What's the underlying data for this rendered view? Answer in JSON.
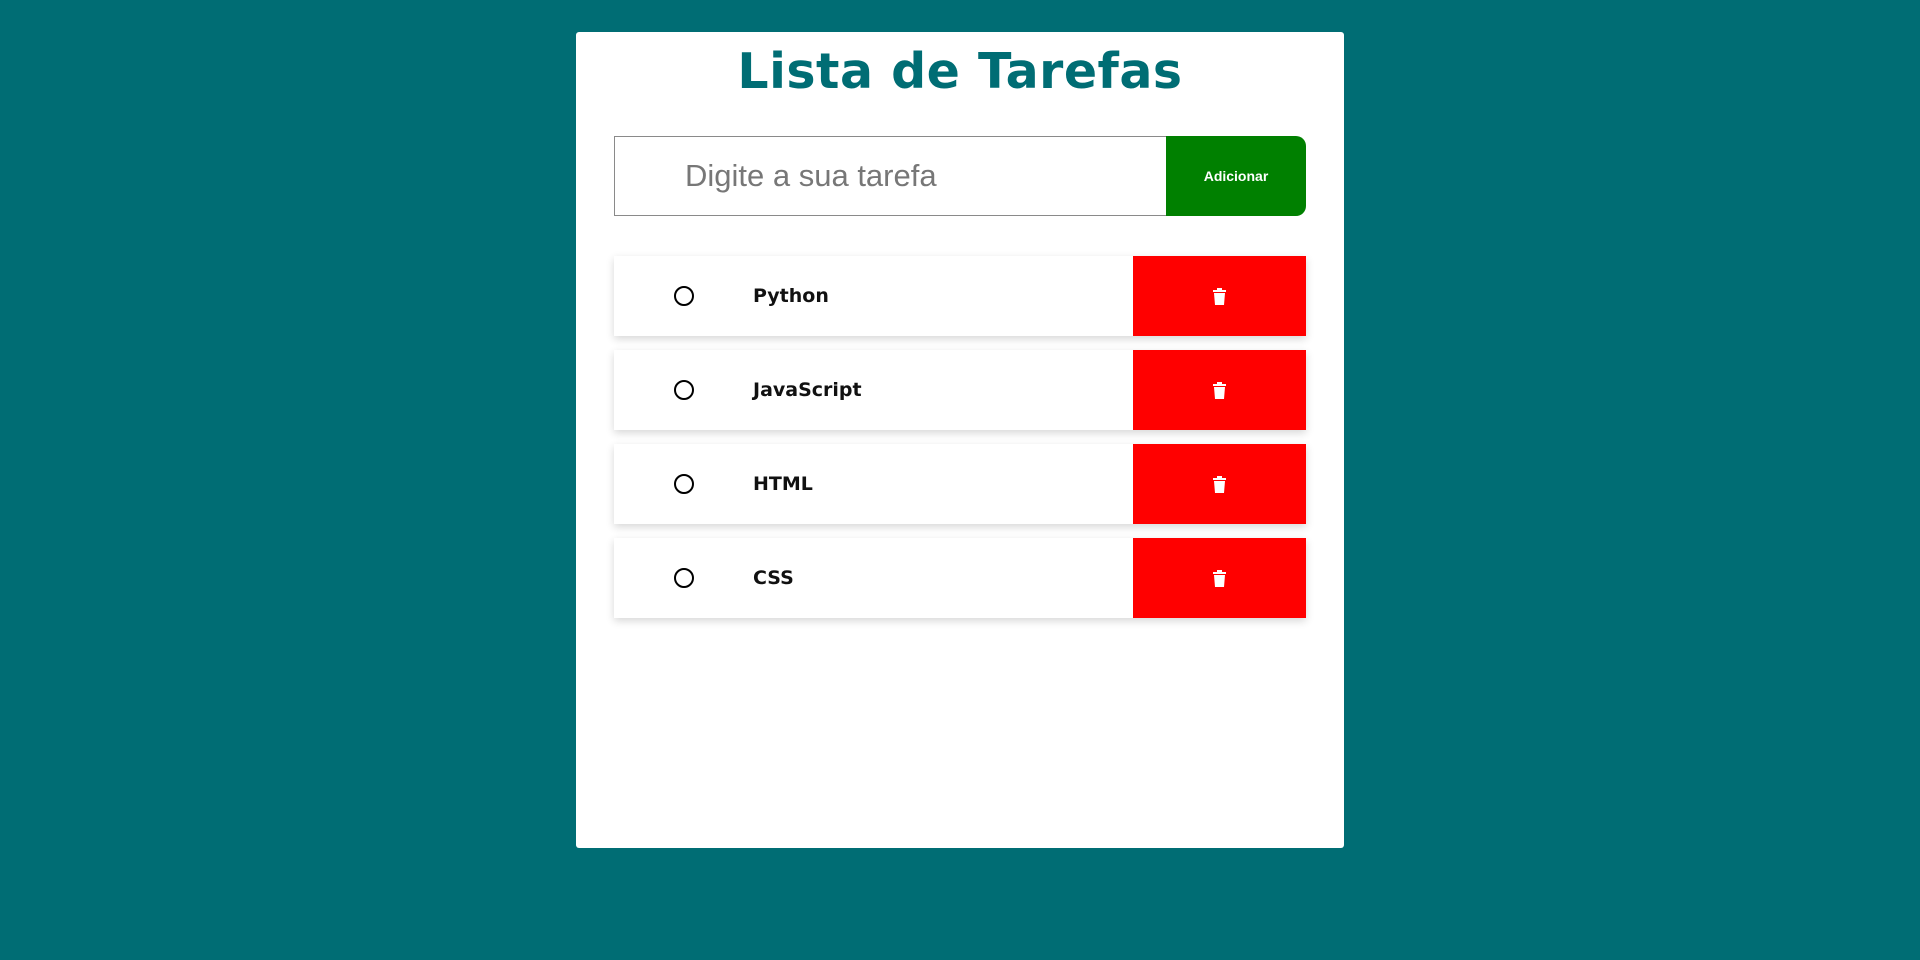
{
  "app": {
    "title": "Lista de Tarefas"
  },
  "colors": {
    "background": "#006d74",
    "card": "#ffffff",
    "title": "#006d74",
    "add_button": "#008000",
    "delete_button": "#ff0000"
  },
  "add_form": {
    "placeholder": "Digite a sua tarefa",
    "value": "",
    "button_label": "Adicionar"
  },
  "tasks": [
    {
      "label": "Python",
      "done": false,
      "check_icon": "circle-outline-icon",
      "delete_icon": "trash-icon"
    },
    {
      "label": "JavaScript",
      "done": false,
      "check_icon": "circle-outline-icon",
      "delete_icon": "trash-icon"
    },
    {
      "label": "HTML",
      "done": false,
      "check_icon": "circle-outline-icon",
      "delete_icon": "trash-icon"
    },
    {
      "label": "CSS",
      "done": false,
      "check_icon": "circle-outline-icon",
      "delete_icon": "trash-icon"
    }
  ]
}
